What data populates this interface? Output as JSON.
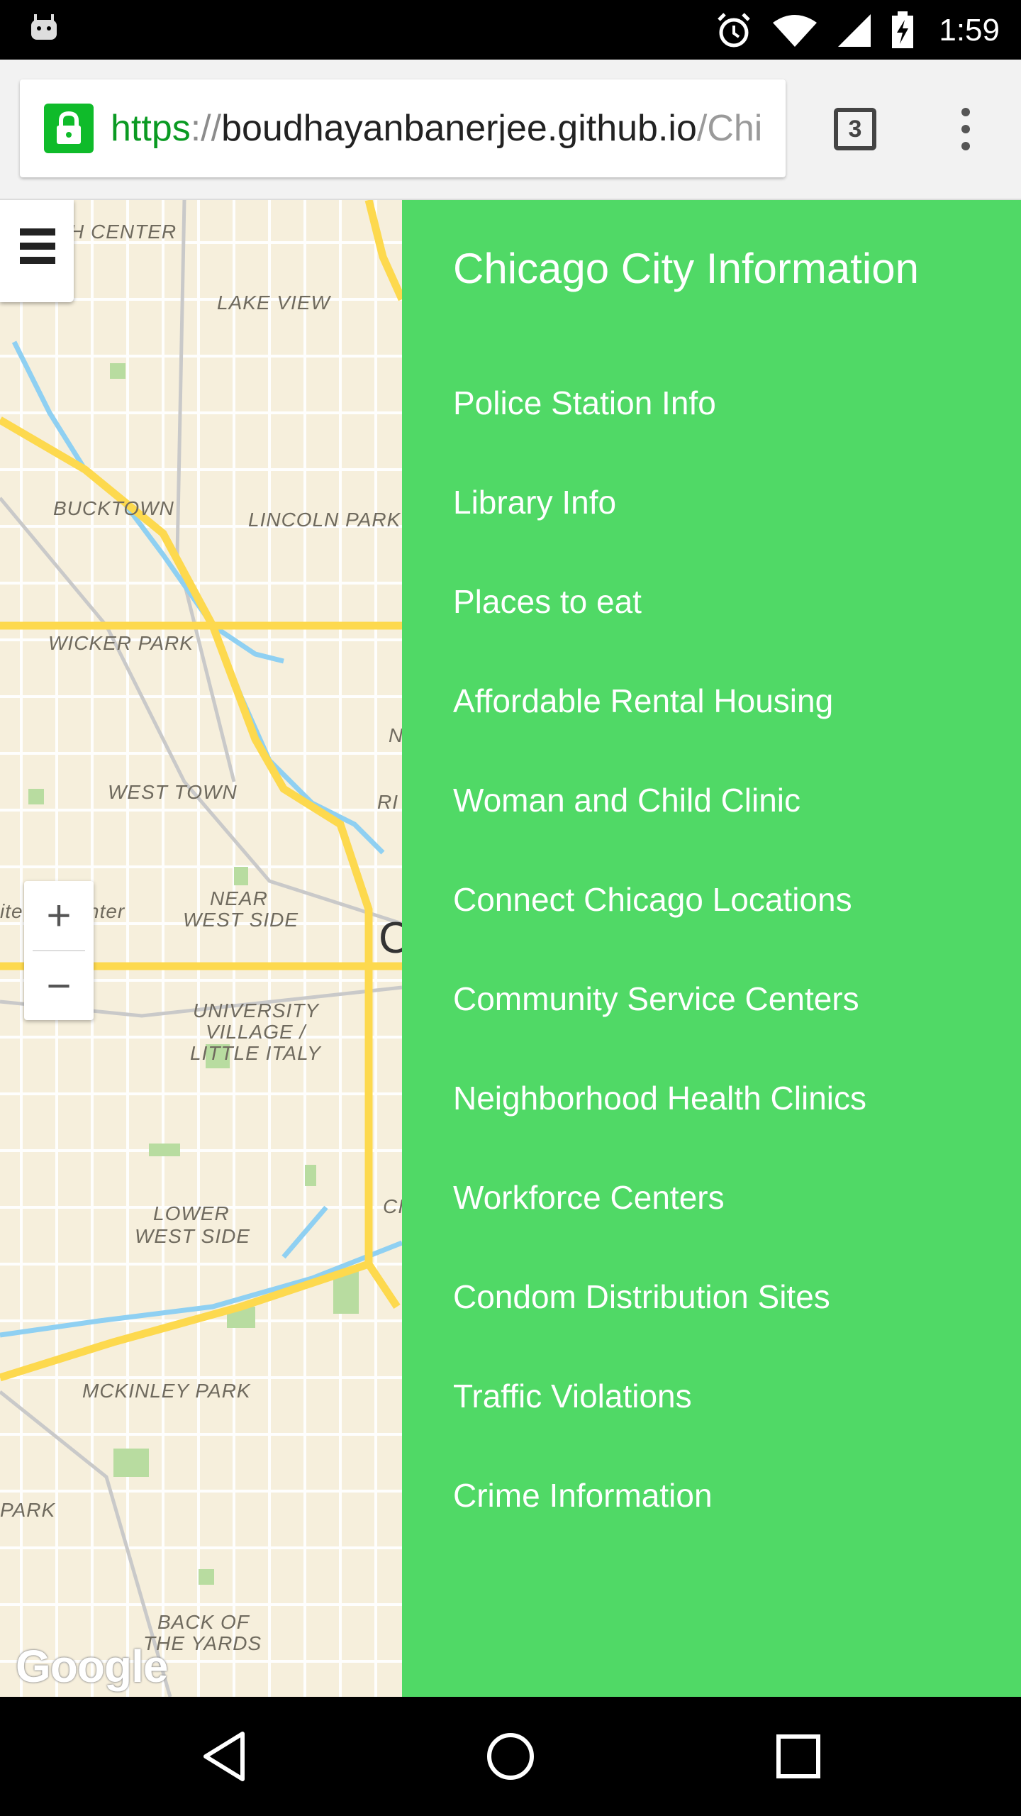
{
  "status_bar": {
    "time": "1:59",
    "icons": [
      "android-notification-icon",
      "alarm-icon",
      "wifi-icon",
      "signal-icon",
      "battery-charging-icon"
    ]
  },
  "browser": {
    "url": {
      "scheme": "https",
      "separator": "://",
      "host": "boudhayanbanerjee.github.io",
      "path": "/Chi"
    },
    "tab_count": "3",
    "icons": [
      "lock-icon",
      "tab-switcher-icon",
      "overflow-menu-icon"
    ]
  },
  "map": {
    "labels": [
      "H CENTER",
      "LAKE VIEW",
      "BUCKTOWN",
      "LINCOLN PARK",
      "WICKER PARK",
      "WEST TOWN",
      "NEAR",
      "WEST SIDE",
      "ite",
      "nter",
      "UNIVERSITY",
      "VILLAGE /",
      "LITTLE ITALY",
      "LOWER",
      "WEST SIDE",
      "MCKINLEY PARK",
      "PARK",
      "BACK OF",
      "THE YARDS",
      "N",
      "RI",
      "C",
      "CI"
    ],
    "zoom_in": "+",
    "zoom_out": "−",
    "attribution": "Google",
    "colors": {
      "land": "#f6efdc",
      "highway": "#fdd94e",
      "water": "#8fd0f2",
      "park": "#b8dca0"
    }
  },
  "panel": {
    "title": "Chicago City Information",
    "items": [
      "Police Station Info",
      "Library Info",
      "Places to eat",
      "Affordable Rental Housing",
      "Woman and Child Clinic",
      "Connect Chicago Locations",
      "Community Service Centers",
      "Neighborhood Health Clinics",
      "Workforce Centers",
      "Condom Distribution Sites",
      "Traffic Violations",
      "Crime Information"
    ],
    "background": "#50d966"
  },
  "nav_bar": {
    "icons": [
      "back-icon",
      "home-icon",
      "recents-icon"
    ]
  }
}
